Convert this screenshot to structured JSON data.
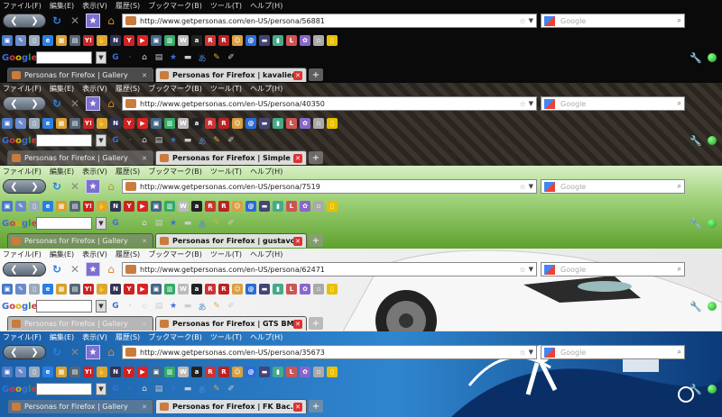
{
  "url_prefix": "http://www.getpersonas.com/en-US/persona/",
  "menu": [
    "ファイル(F)",
    "編集(E)",
    "表示(V)",
    "履歴(S)",
    "ブックマーク(B)",
    "ツール(T)",
    "ヘルプ(H)"
  ],
  "search_placeholder": "Google",
  "google_logo": [
    "G",
    "o",
    "o",
    "g",
    "l",
    "e"
  ],
  "tab_gallery_title": "Personas for Firefox | Gallery",
  "strips": [
    {
      "url": "http://www.getpersonas.com/en-US/persona/56881",
      "active_tab_title": "Personas for Firefox | kavalier"
    },
    {
      "url": "http://www.getpersonas.com/en-US/persona/40350",
      "active_tab_title": "Personas for Firefox | Simple ..."
    },
    {
      "url": "http://www.getpersonas.com/en-US/persona/7519",
      "active_tab_title": "Personas for Firefox | gustavo"
    },
    {
      "url": "http://www.getpersonas.com/en-US/persona/62471",
      "active_tab_title": "Personas for Firefox | GTS BM..."
    },
    {
      "url": "http://www.getpersonas.com/en-US/persona/35673",
      "active_tab_title": "Personas for Firefox | FK Bac..."
    }
  ],
  "bookmark_icons": [
    {
      "name": "folder-icon",
      "color": "#4a78c8",
      "glyph": "▣"
    },
    {
      "name": "edit-icon",
      "color": "#6a8acb",
      "glyph": "✎"
    },
    {
      "name": "page-icon",
      "color": "#9ab",
      "glyph": "▯"
    },
    {
      "name": "ie-icon",
      "color": "#2a7fe0",
      "glyph": "e"
    },
    {
      "name": "image-icon",
      "color": "#d8a030",
      "glyph": "▦"
    },
    {
      "name": "grid-icon",
      "color": "#567",
      "glyph": "▤"
    },
    {
      "name": "yahoo-icon",
      "color": "#c22",
      "glyph": "Y!"
    },
    {
      "name": "hand-icon",
      "color": "#d9a63a",
      "glyph": "✋"
    },
    {
      "name": "nyt-icon",
      "color": "#335",
      "glyph": "N"
    },
    {
      "name": "yahoo-red-icon",
      "color": "#c22",
      "glyph": "Y"
    },
    {
      "name": "youtube-icon",
      "color": "#d22",
      "glyph": "▶"
    },
    {
      "name": "photo-icon",
      "color": "#468",
      "glyph": "▣"
    },
    {
      "name": "table-icon",
      "color": "#3a6",
      "glyph": "▥"
    },
    {
      "name": "wiki-icon",
      "color": "#bbb",
      "glyph": "W"
    },
    {
      "name": "amazon-icon",
      "color": "#222",
      "glyph": "a"
    },
    {
      "name": "r-icon",
      "color": "#c33",
      "glyph": "R"
    },
    {
      "name": "rakuten-icon",
      "color": "#b22",
      "glyph": "R"
    },
    {
      "name": "cat-icon",
      "color": "#d9a040",
      "glyph": "☺"
    },
    {
      "name": "at-icon",
      "color": "#2a6ad8",
      "glyph": "@"
    },
    {
      "name": "card-icon",
      "color": "#447",
      "glyph": "▬"
    },
    {
      "name": "bars-icon",
      "color": "#4a8",
      "glyph": "▮"
    },
    {
      "name": "l-icon",
      "color": "#c55",
      "glyph": "L"
    },
    {
      "name": "flower-icon",
      "color": "#86c",
      "glyph": "✿"
    },
    {
      "name": "lock-icon",
      "color": "#aaa",
      "glyph": "▫"
    },
    {
      "name": "natgeo-icon",
      "color": "#e8c000",
      "glyph": "▯"
    }
  ],
  "google_toolbar_icons": [
    {
      "name": "home-icon",
      "glyph": "⌂",
      "color": "#ddd"
    },
    {
      "name": "news-icon",
      "glyph": "▤",
      "color": "#ccc"
    },
    {
      "name": "star-icon",
      "glyph": "★",
      "color": "#3b6ed6"
    },
    {
      "name": "minus-icon",
      "glyph": "▬",
      "color": "#ccc"
    },
    {
      "name": "translate-icon",
      "glyph": "あ",
      "color": "#4a8ad8"
    },
    {
      "name": "notes-icon",
      "glyph": "✎",
      "color": "#d8b040"
    },
    {
      "name": "pencil-icon",
      "glyph": "✐",
      "color": "#ccc"
    }
  ]
}
